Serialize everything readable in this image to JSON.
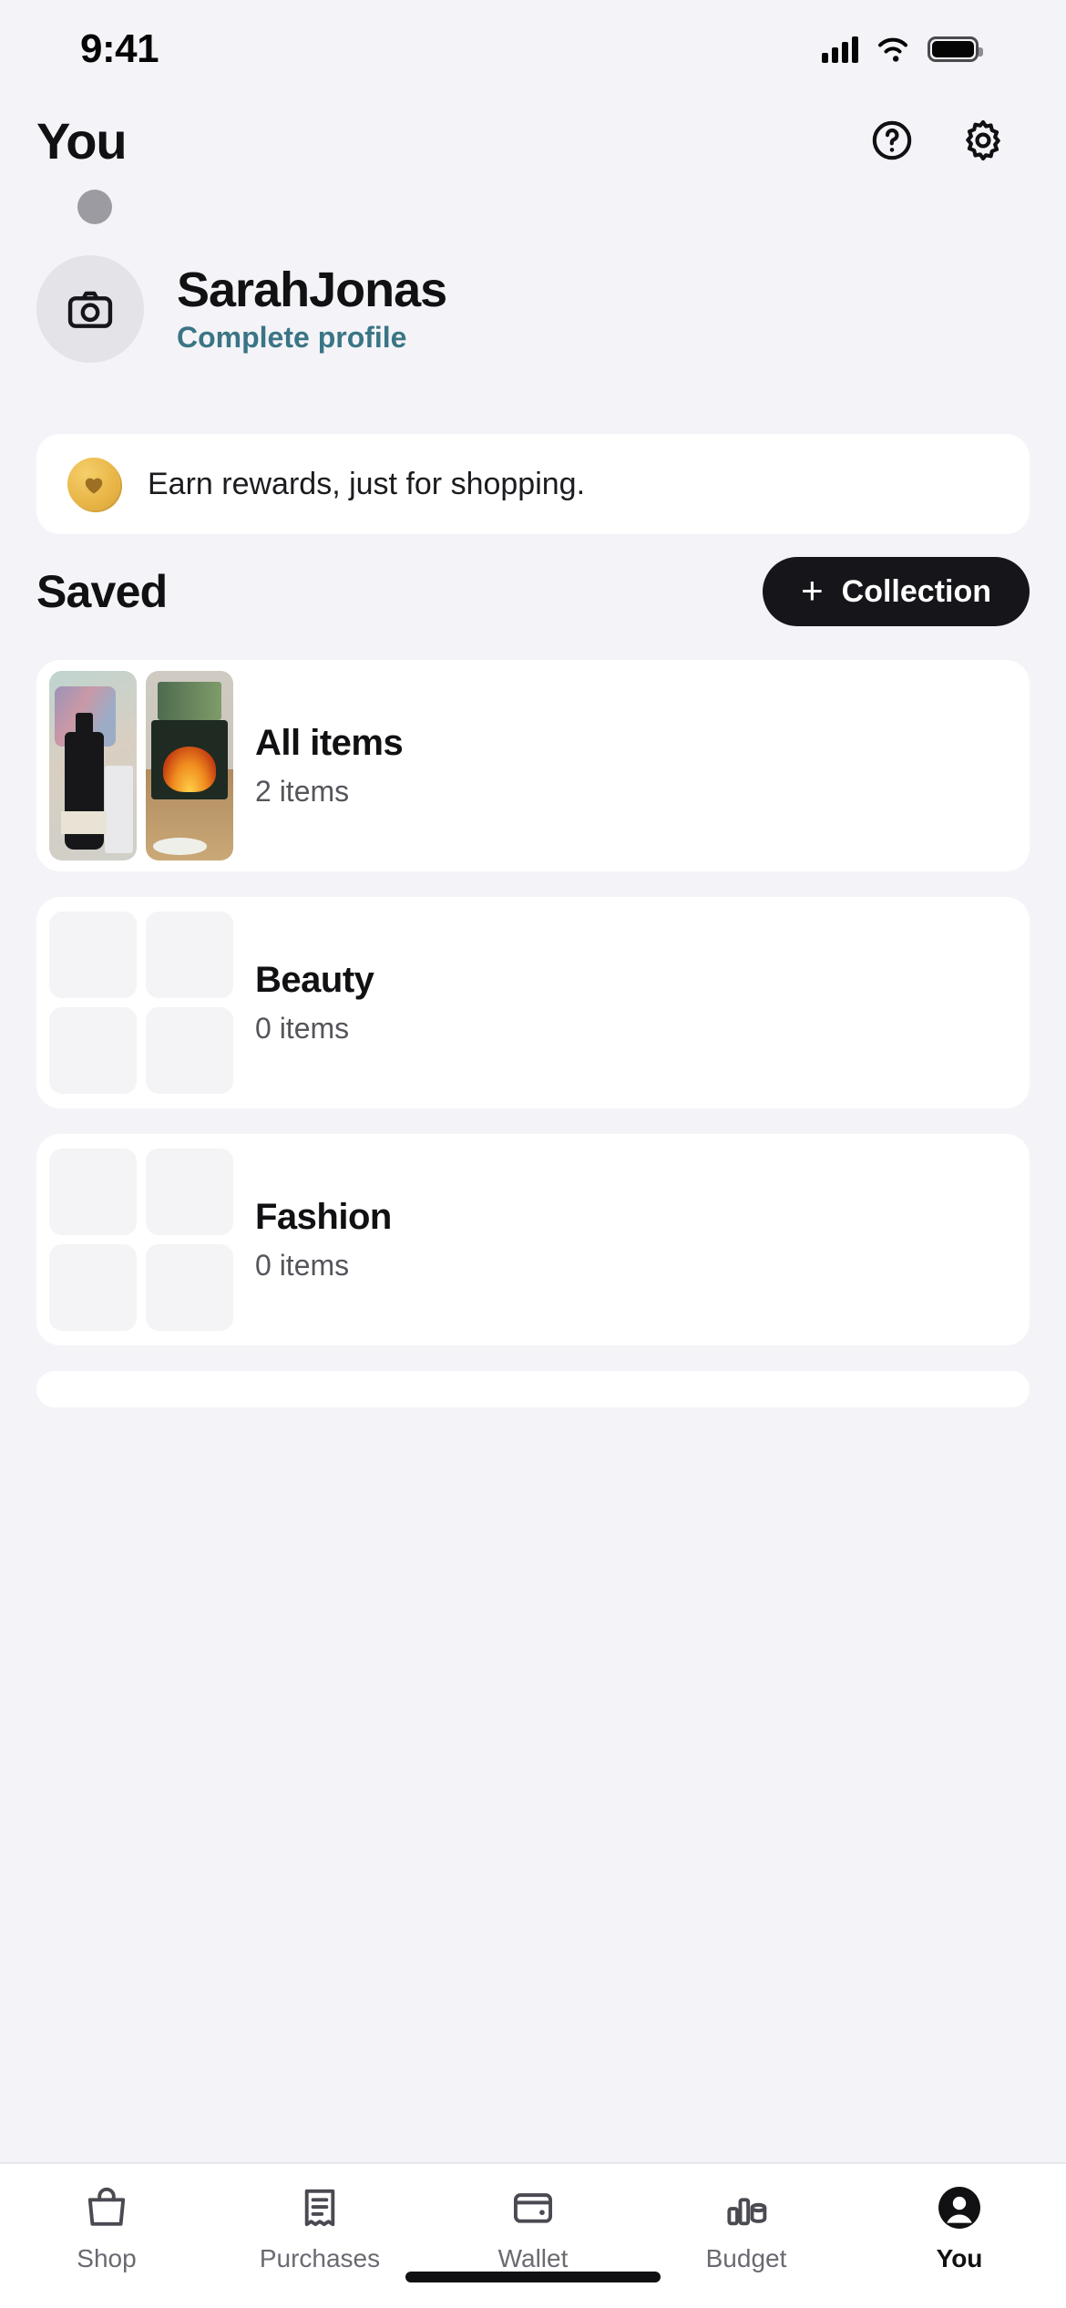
{
  "status_bar": {
    "time": "9:41",
    "cellular_icon": "signal-bars-icon",
    "wifi_icon": "wifi-icon",
    "battery_icon": "battery-full-icon"
  },
  "header": {
    "title": "You",
    "help_icon": "help-circle-icon",
    "settings_icon": "gear-icon"
  },
  "profile": {
    "avatar_icon": "camera-icon",
    "name": "SarahJonas",
    "complete_profile_label": "Complete profile",
    "link_color": "#3a7585"
  },
  "rewards_banner": {
    "icon": "gold-heart-coin-icon",
    "text": "Earn rewards, just for shopping."
  },
  "saved": {
    "title": "Saved",
    "add_button": {
      "plus": "+",
      "label": "Collection"
    }
  },
  "collections": [
    {
      "title": "All items",
      "subtitle": "2 items",
      "thumb_style": "photos"
    },
    {
      "title": "Beauty",
      "subtitle": "0 items",
      "thumb_style": "empty"
    },
    {
      "title": "Fashion",
      "subtitle": "0 items",
      "thumb_style": "empty"
    }
  ],
  "tabs": [
    {
      "label": "Shop",
      "icon": "shopping-bag-icon",
      "active": false
    },
    {
      "label": "Purchases",
      "icon": "receipt-icon",
      "active": false
    },
    {
      "label": "Wallet",
      "icon": "wallet-icon",
      "active": false
    },
    {
      "label": "Budget",
      "icon": "budget-chart-icon",
      "active": false
    },
    {
      "label": "You",
      "icon": "person-circle-icon",
      "active": true
    }
  ]
}
